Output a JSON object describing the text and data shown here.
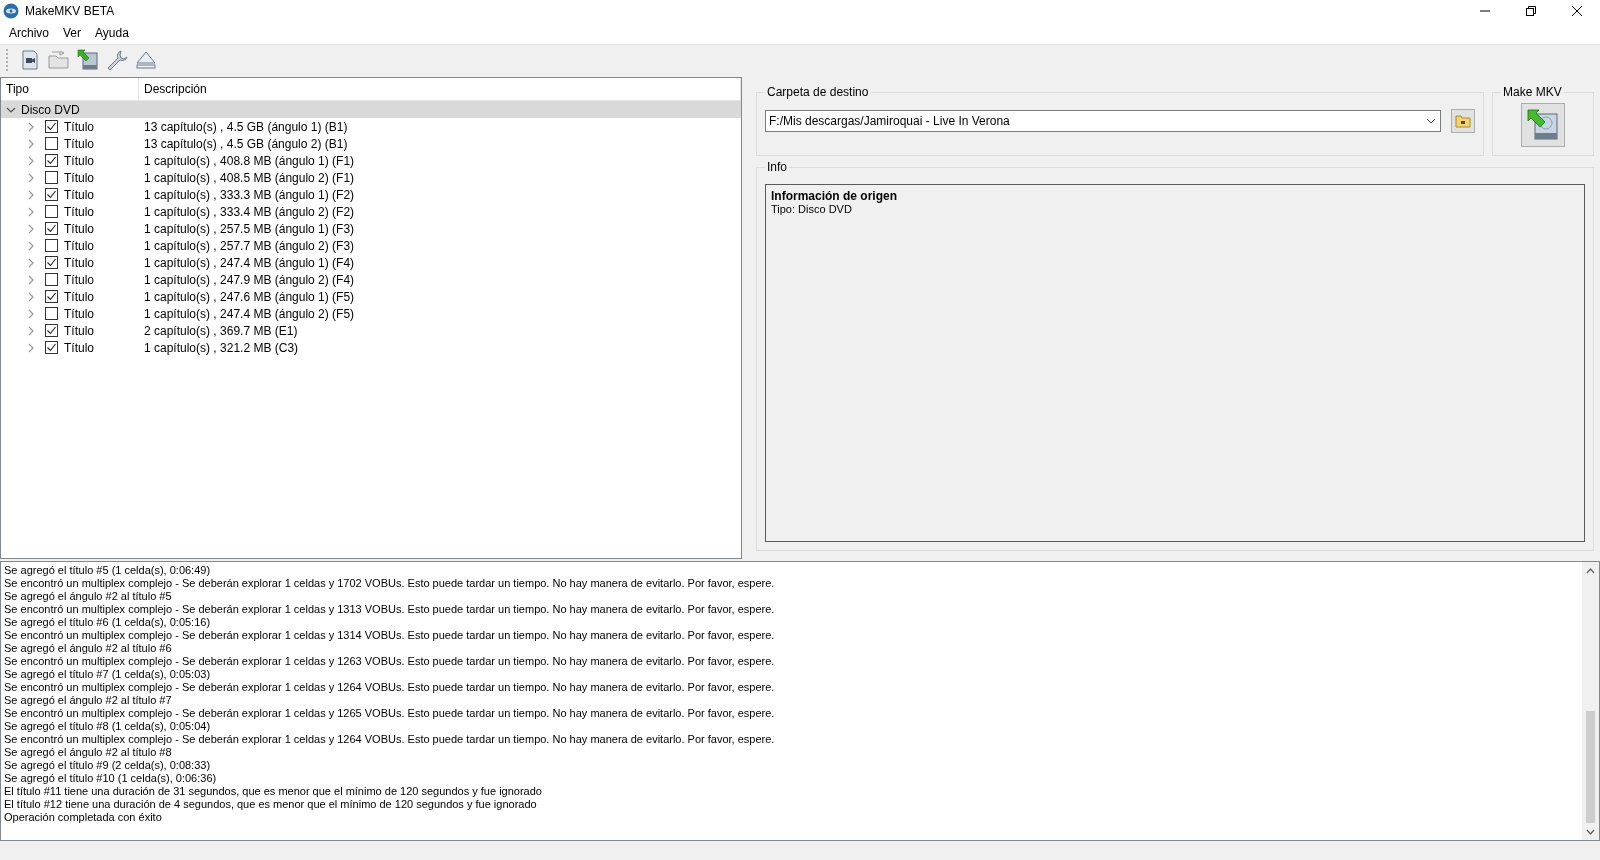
{
  "window": {
    "title": "MakeMKV BETA"
  },
  "menu": [
    "Archivo",
    "Ver",
    "Ayuda"
  ],
  "tree": {
    "columns": [
      "Tipo",
      "Descripción"
    ],
    "root": {
      "label": "Disco DVD",
      "expanded": true,
      "selected": true,
      "children": [
        {
          "label": "Título",
          "description": "13 capítulo(s) , 4.5 GB (ángulo 1) (B1)",
          "checked": true,
          "expanded": false,
          "selected": false
        },
        {
          "label": "Título",
          "description": "13 capítulo(s) , 4.5 GB (ángulo 2) (B1)",
          "checked": false,
          "expanded": false,
          "selected": false
        },
        {
          "label": "Título",
          "description": "1 capítulo(s) , 408.8 MB (ángulo 1) (F1)",
          "checked": true,
          "expanded": false,
          "selected": false
        },
        {
          "label": "Título",
          "description": "1 capítulo(s) , 408.5 MB (ángulo 2) (F1)",
          "checked": false,
          "expanded": false,
          "selected": false
        },
        {
          "label": "Título",
          "description": "1 capítulo(s) , 333.3 MB (ángulo 1) (F2)",
          "checked": true,
          "expanded": false,
          "selected": false
        },
        {
          "label": "Título",
          "description": "1 capítulo(s) , 333.4 MB (ángulo 2) (F2)",
          "checked": false,
          "expanded": false,
          "selected": false
        },
        {
          "label": "Título",
          "description": "1 capítulo(s) , 257.5 MB (ángulo 1) (F3)",
          "checked": true,
          "expanded": false,
          "selected": false
        },
        {
          "label": "Título",
          "description": "1 capítulo(s) , 257.7 MB (ángulo 2) (F3)",
          "checked": false,
          "expanded": false,
          "selected": false
        },
        {
          "label": "Título",
          "description": "1 capítulo(s) , 247.4 MB (ángulo 1) (F4)",
          "checked": true,
          "expanded": false,
          "selected": false
        },
        {
          "label": "Título",
          "description": "1 capítulo(s) , 247.9 MB (ángulo 2) (F4)",
          "checked": false,
          "expanded": false,
          "selected": false
        },
        {
          "label": "Título",
          "description": "1 capítulo(s) , 247.6 MB (ángulo 1) (F5)",
          "checked": true,
          "expanded": false,
          "selected": false
        },
        {
          "label": "Título",
          "description": "1 capítulo(s) , 247.4 MB (ángulo 2) (F5)",
          "checked": false,
          "expanded": false,
          "selected": false
        },
        {
          "label": "Título",
          "description": "2 capítulo(s) , 369.7 MB (E1)",
          "checked": true,
          "expanded": false,
          "selected": false
        },
        {
          "label": "Título",
          "description": "1 capítulo(s) , 321.2 MB (C3)",
          "checked": true,
          "expanded": false,
          "selected": false
        }
      ]
    }
  },
  "destination": {
    "label": "Carpeta de destino",
    "value": "F:/Mis descargas/Jamiroquai - Live In Verona"
  },
  "make_mkv": {
    "label": "Make MKV"
  },
  "info": {
    "label": "Info",
    "heading": "Información de origen",
    "text": "Tipo: Disco DVD"
  },
  "log": [
    "Se agregó el título #5 (1 celda(s), 0:06:49)",
    "Se encontró un multiplex complejo - Se deberán explorar 1 celdas y 1702 VOBUs. Esto puede tardar un tiempo. No hay manera de evitarlo. Por favor, espere.",
    "Se agregó el ángulo #2 al título #5",
    "Se encontró un multiplex complejo - Se deberán explorar 1 celdas y 1313 VOBUs. Esto puede tardar un tiempo. No hay manera de evitarlo. Por favor, espere.",
    "Se agregó el título #6 (1 celda(s), 0:05:16)",
    "Se encontró un multiplex complejo - Se deberán explorar 1 celdas y 1314 VOBUs. Esto puede tardar un tiempo. No hay manera de evitarlo. Por favor, espere.",
    "Se agregó el ángulo #2 al título #6",
    "Se encontró un multiplex complejo - Se deberán explorar 1 celdas y 1263 VOBUs. Esto puede tardar un tiempo. No hay manera de evitarlo. Por favor, espere.",
    "Se agregó el título #7 (1 celda(s), 0:05:03)",
    "Se encontró un multiplex complejo - Se deberán explorar 1 celdas y 1264 VOBUs. Esto puede tardar un tiempo. No hay manera de evitarlo. Por favor, espere.",
    "Se agregó el ángulo #2 al título #7",
    "Se encontró un multiplex complejo - Se deberán explorar 1 celdas y 1265 VOBUs. Esto puede tardar un tiempo. No hay manera de evitarlo. Por favor, espere.",
    "Se agregó el título #8 (1 celda(s), 0:05:04)",
    "Se encontró un multiplex complejo - Se deberán explorar 1 celdas y 1264 VOBUs. Esto puede tardar un tiempo. No hay manera de evitarlo. Por favor, espere.",
    "Se agregó el ángulo #2 al título #8",
    "Se agregó el título #9 (2 celda(s), 0:08:33)",
    "Se agregó el título #10 (1 celda(s), 0:06:36)",
    "El título #11 tiene una duración de 31 segundos, que es menor que el mínimo de 120 segundos y fue ignorado",
    "El título #12 tiene una duración de 4 segundos, que es menor que el mínimo de 120 segundos y fue ignorado",
    "Operación completada con éxito"
  ]
}
